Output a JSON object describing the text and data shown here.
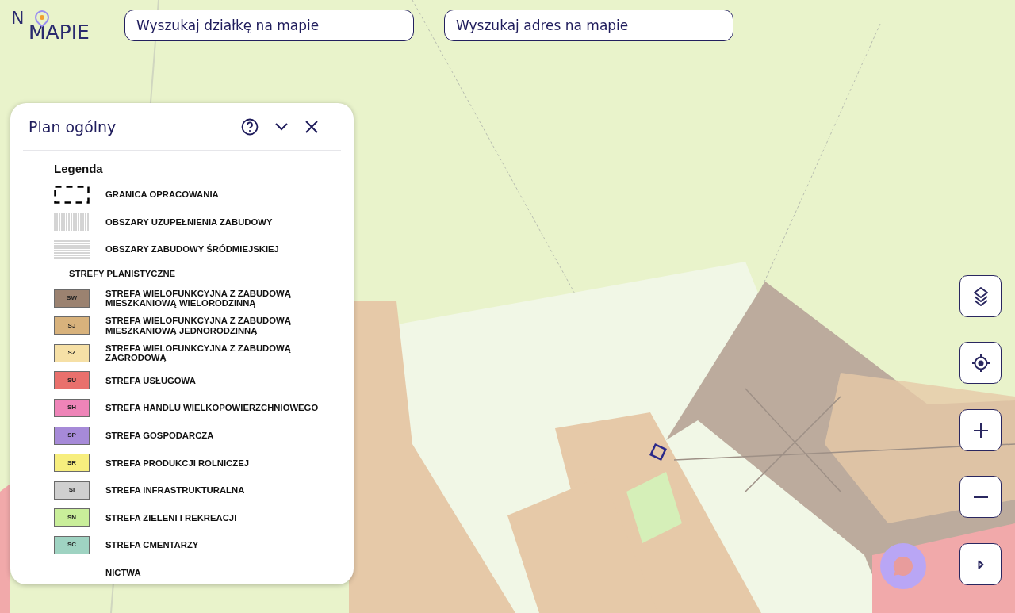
{
  "logo": {
    "top": "N",
    "bottom": "MAPIE"
  },
  "searches": [
    {
      "placeholder": "Wyszukaj działkę na mapie"
    },
    {
      "placeholder": "Wyszukaj adres na mapie"
    }
  ],
  "panel": {
    "title": "Plan ogólny",
    "legend_title": "Legenda",
    "items": [
      {
        "kind": "boundary",
        "label": "GRANICA OPRACOWANIA"
      },
      {
        "kind": "vstripes",
        "label": "OBSZARY UZUPEŁNIENIA ZABUDOWY"
      },
      {
        "kind": "hstripes",
        "label": "OBSZARY ZABUDOWY ŚRÓDMIEJSKIEJ"
      },
      {
        "kind": "heading",
        "label": "STREFY PLANISTYCZNE"
      },
      {
        "kind": "swatch",
        "code": "SW",
        "color": "#9b8270",
        "label": "STREFA WIELOFUNKCYJNA Z ZABUDOWĄ MIESZKANIOWĄ WIELORODZINNĄ"
      },
      {
        "kind": "swatch",
        "code": "SJ",
        "color": "#d8b27c",
        "label": "STREFA WIELOFUNKCYJNA Z ZABUDOWĄ MIESZKANIOWĄ JEDNORODZINNĄ"
      },
      {
        "kind": "swatch",
        "code": "SZ",
        "color": "#f6e0a6",
        "label": "STREFA WIELOFUNKCYJNA Z ZABUDOWĄ ZAGRODOWĄ"
      },
      {
        "kind": "swatch",
        "code": "SU",
        "color": "#e9706c",
        "label": "STREFA USŁUGOWA"
      },
      {
        "kind": "swatch",
        "code": "SH",
        "color": "#ee84b8",
        "label": "STREFA HANDLU WIELKOPOWIERZCHNIOWEGO"
      },
      {
        "kind": "swatch",
        "code": "SP",
        "color": "#a68ad8",
        "label": "STREFA GOSPODARCZA"
      },
      {
        "kind": "swatch",
        "code": "SR",
        "color": "#f7ee7e",
        "label": "STREFA PRODUKCJI ROLNICZEJ"
      },
      {
        "kind": "swatch",
        "code": "SI",
        "color": "#cfcfcf",
        "label": "STREFA INFRASTRUKTURALNA"
      },
      {
        "kind": "swatch",
        "code": "SN",
        "color": "#c9ee9a",
        "label": "STREFA ZIELENI I REKREACJI"
      },
      {
        "kind": "swatch",
        "code": "SC",
        "color": "#9fd3c2",
        "label": "STREFA CMENTARZY"
      },
      {
        "kind": "label",
        "label": "NICTWA"
      }
    ]
  }
}
